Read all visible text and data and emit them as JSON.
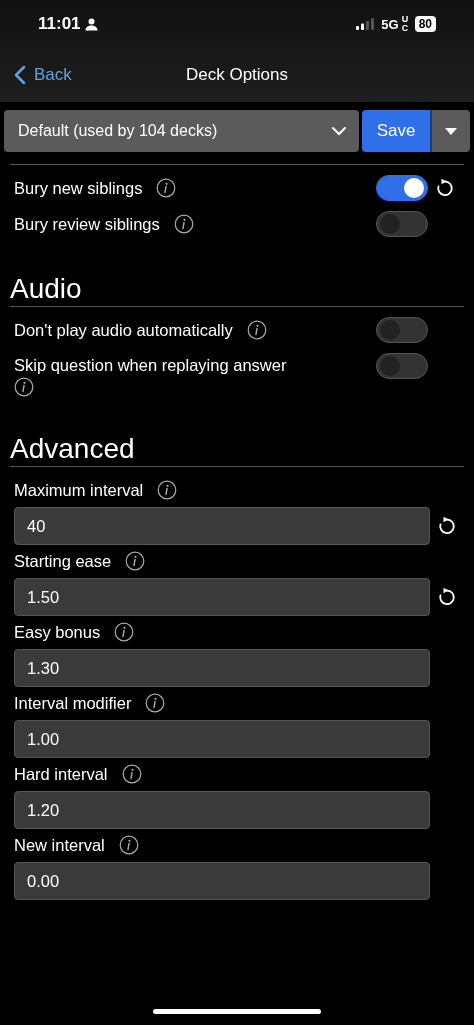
{
  "status_bar": {
    "time": "11:01",
    "network": "5G",
    "network_suffix": "UC",
    "battery": "80"
  },
  "nav": {
    "back": "Back",
    "title": "Deck Options"
  },
  "preset": {
    "value": "Default (used by 104 decks)",
    "save": "Save"
  },
  "sections": [
    {
      "rows": [
        {
          "kind": "toggle",
          "label": "Bury new siblings",
          "on": true,
          "reset": true
        },
        {
          "kind": "toggle",
          "label": "Bury review siblings",
          "on": false,
          "reset": false
        }
      ]
    },
    {
      "title": "Audio",
      "rows": [
        {
          "kind": "toggle",
          "label": "Don't play audio automatically",
          "on": false,
          "reset": false
        },
        {
          "kind": "toggle",
          "label": "Skip question when replaying answer",
          "on": false,
          "reset": false
        }
      ]
    },
    {
      "title": "Advanced",
      "rows": [
        {
          "kind": "number",
          "label": "Maximum interval",
          "value": "40",
          "reset": true
        },
        {
          "kind": "number",
          "label": "Starting ease",
          "value": "1.50",
          "reset": true
        },
        {
          "kind": "number",
          "label": "Easy bonus",
          "value": "1.30",
          "reset": false
        },
        {
          "kind": "number",
          "label": "Interval modifier",
          "value": "1.00",
          "reset": false
        },
        {
          "kind": "number",
          "label": "Hard interval",
          "value": "1.20",
          "reset": false
        },
        {
          "kind": "number",
          "label": "New interval",
          "value": "0.00",
          "reset": false
        }
      ]
    }
  ]
}
